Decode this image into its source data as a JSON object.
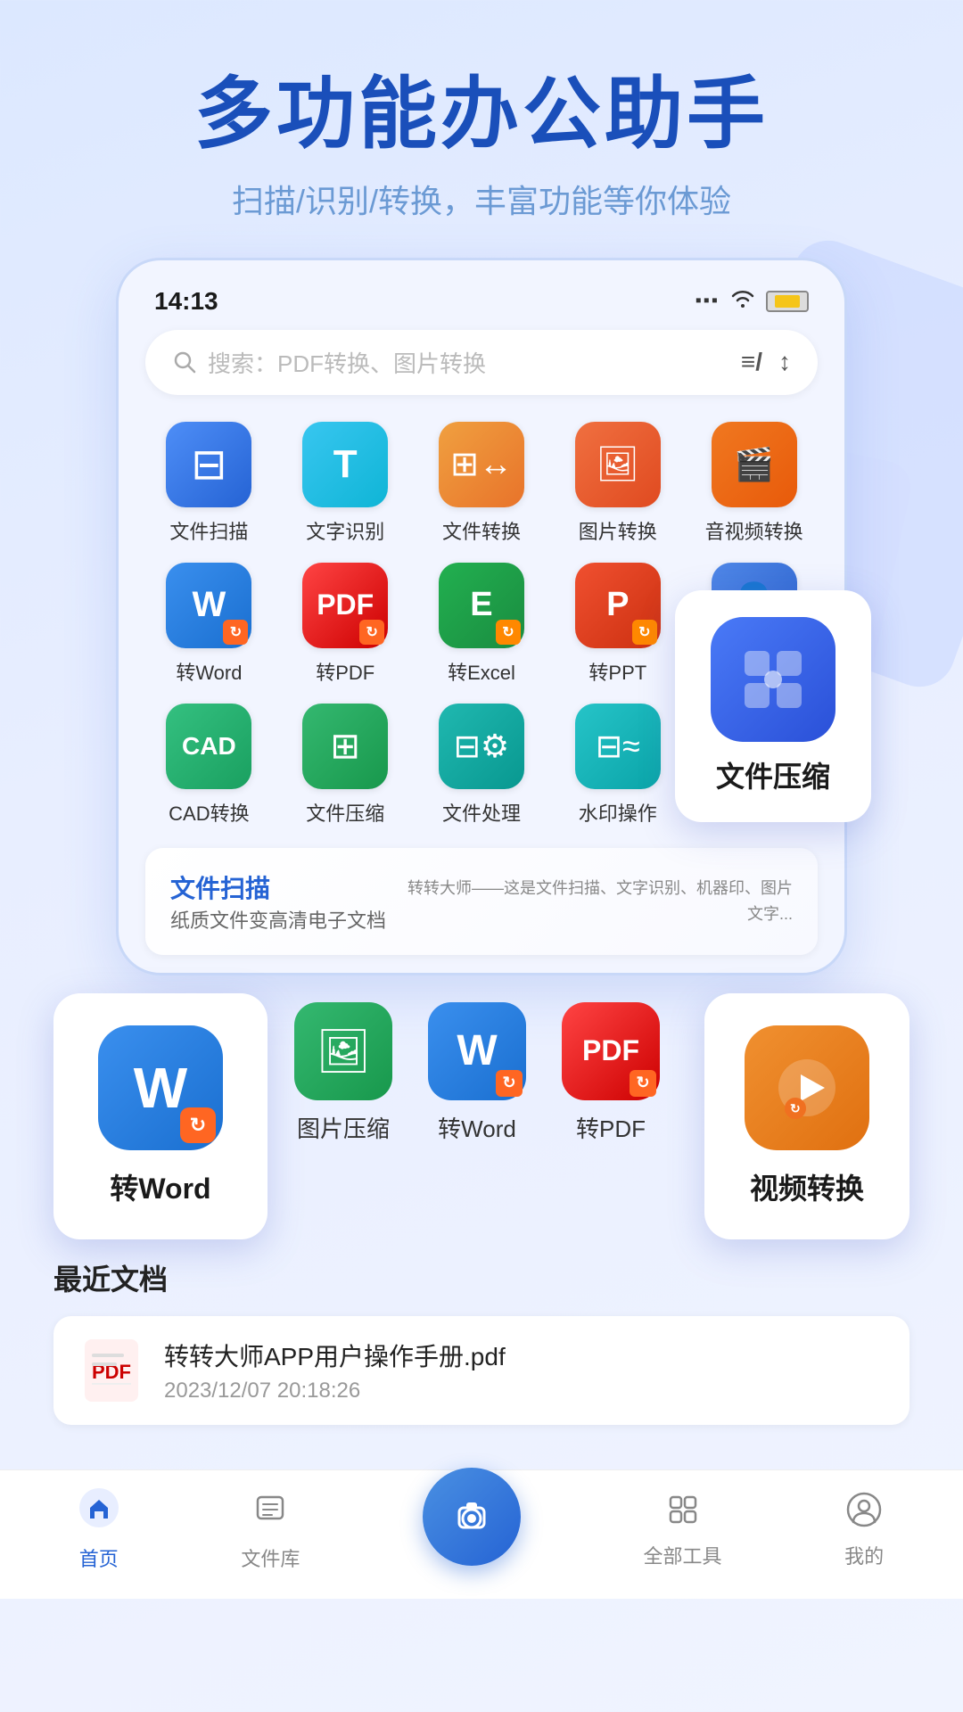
{
  "hero": {
    "title": "多功能办公助手",
    "subtitle": "扫描/识别/转换，丰富功能等你体验"
  },
  "status": {
    "time": "14:13",
    "signal": "▪▪▪",
    "wifi": "📶",
    "battery": "🔋"
  },
  "search": {
    "placeholder": "搜索：PDF转换、图片转换"
  },
  "tools": [
    {
      "id": "scan",
      "label": "文件扫描",
      "icon": "scan"
    },
    {
      "id": "ocr",
      "label": "文字识别",
      "icon": "ocr"
    },
    {
      "id": "convert",
      "label": "文件转换",
      "icon": "convert"
    },
    {
      "id": "image",
      "label": "图片转换",
      "icon": "image"
    },
    {
      "id": "media",
      "label": "音视频转换",
      "icon": "media"
    },
    {
      "id": "word",
      "label": "转Word",
      "icon": "word"
    },
    {
      "id": "pdf",
      "label": "转PDF",
      "icon": "pdf"
    },
    {
      "id": "excel",
      "label": "转Excel",
      "icon": "excel"
    },
    {
      "id": "ppt",
      "label": "转PPT",
      "icon": "ppt"
    },
    {
      "id": "person",
      "label": "",
      "icon": "person"
    },
    {
      "id": "cad",
      "label": "CAD转换",
      "icon": "cad"
    },
    {
      "id": "compress",
      "label": "文件压缩",
      "icon": "compress"
    },
    {
      "id": "fileprocess",
      "label": "文件处理",
      "icon": "fileprocess"
    },
    {
      "id": "watermark",
      "label": "水印操作",
      "icon": "watermark"
    }
  ],
  "floating_compress": {
    "label": "文件压缩"
  },
  "banner": {
    "title": "文件扫描",
    "desc": "纸质文件变高清电子文档",
    "preview_text": "转转大师——这是文件扫描、文字识别、机器印、图片文字..."
  },
  "floating_word": {
    "label": "转Word"
  },
  "small_tools": [
    {
      "id": "img-compress",
      "label": "图片压缩",
      "icon": "img-compress"
    },
    {
      "id": "to-word",
      "label": "转Word",
      "icon": "to-word"
    },
    {
      "id": "to-pdf",
      "label": "转PDF",
      "icon": "to-pdf"
    }
  ],
  "floating_video": {
    "label": "视频转换"
  },
  "recent": {
    "title": "最近文档",
    "docs": [
      {
        "name": "转转大师APP用户操作手册.pdf",
        "date": "2023/12/07 20:18:26",
        "icon": "pdf"
      }
    ]
  },
  "nav": {
    "items": [
      {
        "id": "home",
        "label": "首页",
        "active": true,
        "icon": "🏠"
      },
      {
        "id": "files",
        "label": "文件库",
        "active": false,
        "icon": "📋"
      },
      {
        "id": "camera",
        "label": "",
        "active": false,
        "icon": "📷"
      },
      {
        "id": "tools",
        "label": "全部工具",
        "active": false,
        "icon": "⊞"
      },
      {
        "id": "mine",
        "label": "我的",
        "active": false,
        "icon": "⏱"
      }
    ]
  }
}
